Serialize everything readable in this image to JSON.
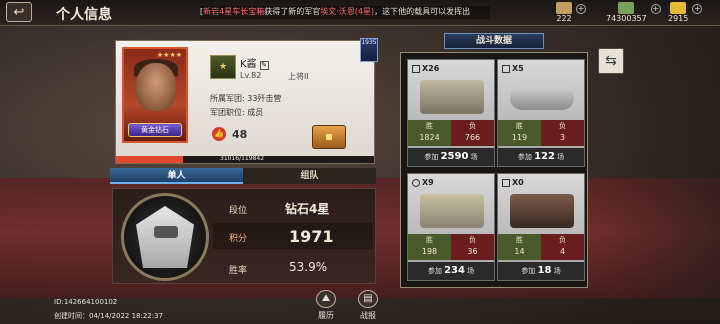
{
  "header": {
    "title": "个人信息",
    "back_label": "↩",
    "marquee_prefix": "[",
    "marquee_name": "新岩4星车长宝箱",
    "marquee_mid": "获得了新的军官",
    "marquee_officer": "埃文·沃恩(4星)",
    "marquee_suffix": "，这下他的载具可以发挥出"
  },
  "resources": [
    {
      "label": "222",
      "icon": "medal-icon"
    },
    {
      "label": "74300357",
      "icon": "cash-icon"
    },
    {
      "label": "2915",
      "icon": "gold-icon"
    }
  ],
  "profile": {
    "name": "K酱",
    "level": "Lv.82",
    "rank_title": "上将II",
    "corps": "所属军团: 33歼击营",
    "duty": "军团职位: 成员",
    "likes": "48",
    "avatar_badge": "黄金钻石",
    "avatar_stars": "★★★★",
    "progress_text": "31016/119842",
    "progress_fraction": 0.259,
    "flag_label": "1935"
  },
  "tabs": [
    {
      "label": "单人",
      "active": true
    },
    {
      "label": "组队",
      "active": false
    }
  ],
  "rank": {
    "tier_label": "段位",
    "tier_value": "钻石4星",
    "score_label": "积分",
    "score_value": "1971",
    "winrate_label": "胜率",
    "winrate_value": "53.9%"
  },
  "battle_data": {
    "title": "战斗数据",
    "win_label": "胜",
    "lose_label": "负",
    "join_label": "参加",
    "times_label": "场",
    "units": [
      {
        "count": "X26",
        "icon": "tank-icon",
        "wins": "1824",
        "losses": "766",
        "total": "2590"
      },
      {
        "count": "X5",
        "icon": "helicopter-icon",
        "wins": "119",
        "losses": "3",
        "total": "122"
      },
      {
        "count": "X9",
        "icon": "ifv-icon",
        "wins": "198",
        "losses": "36",
        "total": "234"
      },
      {
        "count": "X0",
        "icon": "artillery-icon",
        "wins": "14",
        "losses": "4",
        "total": "18"
      }
    ]
  },
  "footer": {
    "id_text": "ID:142664100102",
    "created_text": "创建时间：04/14/2022 18:22:37",
    "history_label": "履历",
    "report_label": "战报"
  }
}
